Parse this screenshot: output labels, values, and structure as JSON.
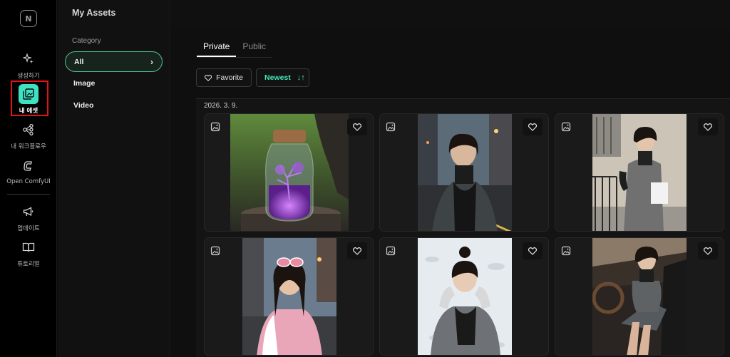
{
  "rail": {
    "items": [
      {
        "label": "생성하기",
        "icon": "sparkles-icon"
      },
      {
        "label": "내 에셋",
        "icon": "assets-icon"
      },
      {
        "label": "내 워크플로우",
        "icon": "workflow-icon"
      },
      {
        "label": "Open ComfyUI",
        "icon": "comfyui-icon"
      },
      {
        "label": "업데이트",
        "icon": "megaphone-icon"
      },
      {
        "label": "튜토리얼",
        "icon": "book-icon"
      }
    ]
  },
  "panel": {
    "title": "My Assets",
    "category_label": "Category",
    "categories": [
      "All",
      "Image",
      "Video"
    ],
    "selected": "All"
  },
  "main": {
    "tabs": [
      "Private",
      "Public"
    ],
    "active_tab": "Private",
    "favorite_label": "Favorite",
    "sort_label": "Newest",
    "date": "2026. 3. 9.",
    "items_count": 6
  },
  "colors": {
    "accent": "#46e6b6",
    "highlight": "#e5121a"
  }
}
